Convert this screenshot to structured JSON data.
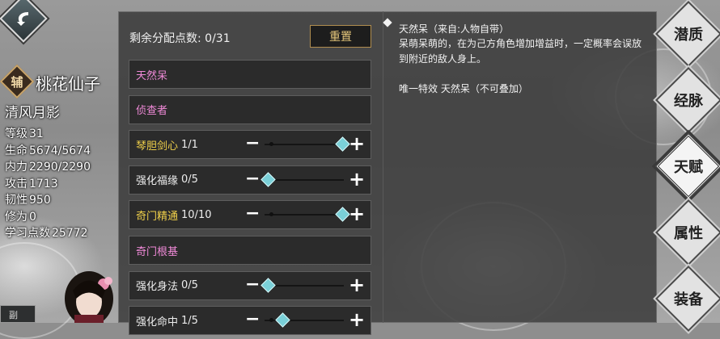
{
  "character": {
    "role_badge": "辅",
    "name": "桃花仙子",
    "title": "清风月影",
    "stats": [
      {
        "label": "等级",
        "value": "31"
      },
      {
        "label": "生命",
        "value": "5674/5674"
      },
      {
        "label": "内力",
        "value": "2290/2290"
      },
      {
        "label": "攻击",
        "value": "1713"
      },
      {
        "label": "韧性",
        "value": "950"
      },
      {
        "label": "修为",
        "value": "0"
      },
      {
        "label": "学习点数",
        "value": "25772"
      }
    ]
  },
  "panel": {
    "remaining_label": "剩余分配点数: 0/31",
    "reset_label": "重置"
  },
  "talents": [
    {
      "name": "天然呆",
      "color": "pink",
      "level": "",
      "has_slider": false
    },
    {
      "name": "侦查者",
      "color": "pink",
      "level": "",
      "has_slider": false
    },
    {
      "name": "琴胆剑心",
      "color": "gold",
      "level": "1/1",
      "has_slider": true,
      "fill": 1.0
    },
    {
      "name": "强化福缘",
      "color": "white",
      "level": "0/5",
      "has_slider": true,
      "fill": 0.0
    },
    {
      "name": "奇门精通",
      "color": "gold",
      "level": "10/10",
      "has_slider": true,
      "fill": 1.0
    },
    {
      "name": "奇门根基",
      "color": "pink",
      "level": "",
      "has_slider": false
    },
    {
      "name": "强化身法",
      "color": "white",
      "level": "0/5",
      "has_slider": true,
      "fill": 0.0
    },
    {
      "name": "强化命中",
      "color": "white",
      "level": "1/5",
      "has_slider": true,
      "fill": 0.2
    }
  ],
  "description": {
    "title": "天然呆（来自:人物自带）",
    "body": "呆萌呆萌的，在为己方角色增加增益时，一定概率会误放到附近的敌人身上。",
    "effect": "唯一特效 天然呆（不可叠加）"
  },
  "tabs": [
    {
      "label": "潜质",
      "active": false
    },
    {
      "label": "经脉",
      "active": false
    },
    {
      "label": "天赋",
      "active": true
    },
    {
      "label": "属性",
      "active": false
    },
    {
      "label": "装备",
      "active": false
    }
  ],
  "left_tag": "副",
  "controls": {
    "minus": "−",
    "plus": "+"
  }
}
